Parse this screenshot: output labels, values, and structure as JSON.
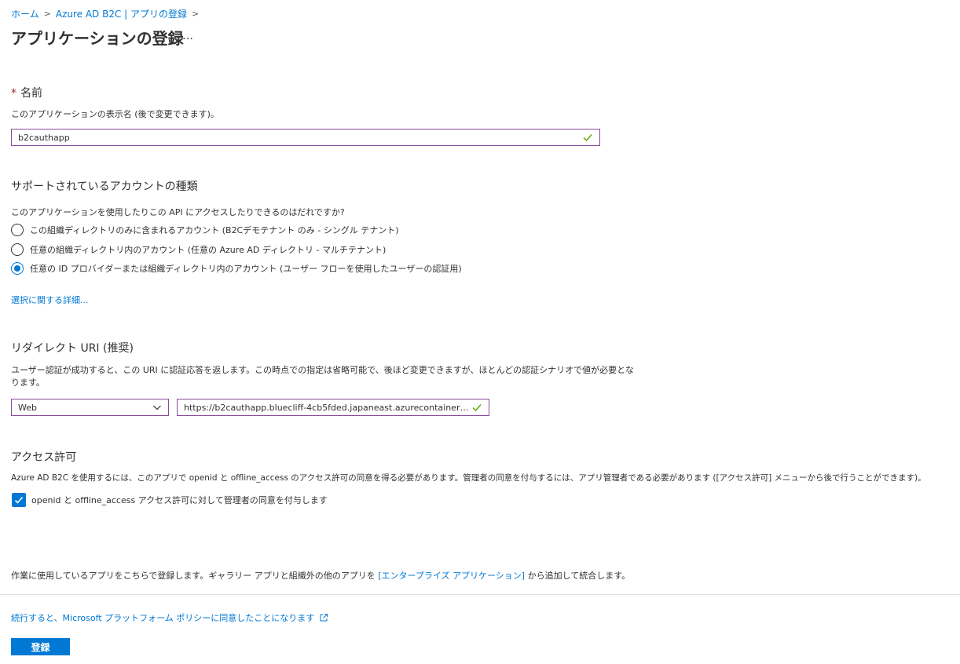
{
  "breadcrumb": {
    "home": "ホーム",
    "parent": "Azure AD B2C | アプリの登録"
  },
  "page": {
    "title": "アプリケーションの登録",
    "more": "…"
  },
  "name_section": {
    "required_mark": "*",
    "label": "名前",
    "description": "このアプリケーションの表示名 (後で変更できます)。",
    "value": "b2cauthapp"
  },
  "account_types": {
    "heading": "サポートされているアカウントの種類",
    "question": "このアプリケーションを使用したりこの API にアクセスしたりできるのはだれですか?",
    "options": [
      {
        "label": "この組織ディレクトリのみに含まれるアカウント (B2Cデモテナント のみ - シングル テナント)",
        "selected": false
      },
      {
        "label": "任意の組織ディレクトリ内のアカウント (任意の Azure AD ディレクトリ - マルチテナント)",
        "selected": false
      },
      {
        "label": "任意の ID プロバイダーまたは組織ディレクトリ内のアカウント (ユーザー フローを使用したユーザーの認証用)",
        "selected": true
      }
    ],
    "help_link": "選択に関する詳細..."
  },
  "redirect": {
    "heading": "リダイレクト URI (推奨)",
    "description_line1": "ユーザー認証が成功すると、この URI に認証応答を返します。この時点での指定は省略可能で、後ほど変更できますが、ほとんどの認証シナリオで値が必要とな",
    "description_line2": "ります。",
    "platform": "Web",
    "uri": "https://b2cauthapp.bluecliff-4cb5fded.japaneast.azurecontainerapp..."
  },
  "permissions": {
    "heading": "アクセス許可",
    "description": "Azure AD B2C を使用するには、このアプリで openid と offline_access のアクセス許可の同意を得る必要があります。管理者の同意を付与するには、アプリ管理者である必要があります ([アクセス許可] メニューから後で行うことができます)。",
    "checkbox_label": "openid と offline_access アクセス許可に対して管理者の同意を付与します",
    "checked": true
  },
  "footer": {
    "note_prefix": "作業に使用しているアプリをこちらで登録します。ギャラリー アプリと組織外の他のアプリを",
    "note_link": "[エンタープライズ アプリケーション]",
    "note_suffix": "から追加して統合します。",
    "policy_link": "続行すると、Microsoft プラットフォーム ポリシーに同意したことになります",
    "register_button": "登録"
  },
  "colors": {
    "accent": "#0078d4",
    "input_border": "#8a4b9c",
    "valid_check": "#57a300",
    "required": "#a4262c"
  }
}
